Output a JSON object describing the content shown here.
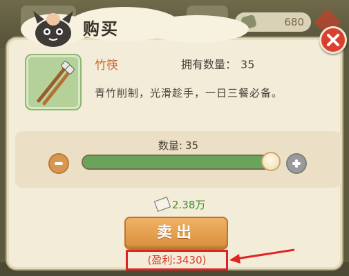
{
  "header": {
    "title": "购买",
    "background_counter": "680"
  },
  "item": {
    "name": "竹筷",
    "owned_label": "拥有数量：",
    "owned_value": "35",
    "description": "青竹削制，光滑趁手，一日三餐必备。"
  },
  "quantity": {
    "label": "数量:",
    "value": "35",
    "slider_fraction": 1.0
  },
  "price": {
    "value": "2.38万"
  },
  "actions": {
    "sell_label": "卖出"
  },
  "annotation": {
    "profit_text": "(盈利:3430)"
  },
  "colors": {
    "accent": "#d98f3b",
    "name": "#c4692c",
    "price": "#3c8c2a",
    "slider_fill": "#6aa35b",
    "close": "#d9402f",
    "annotation": "#e02424"
  }
}
